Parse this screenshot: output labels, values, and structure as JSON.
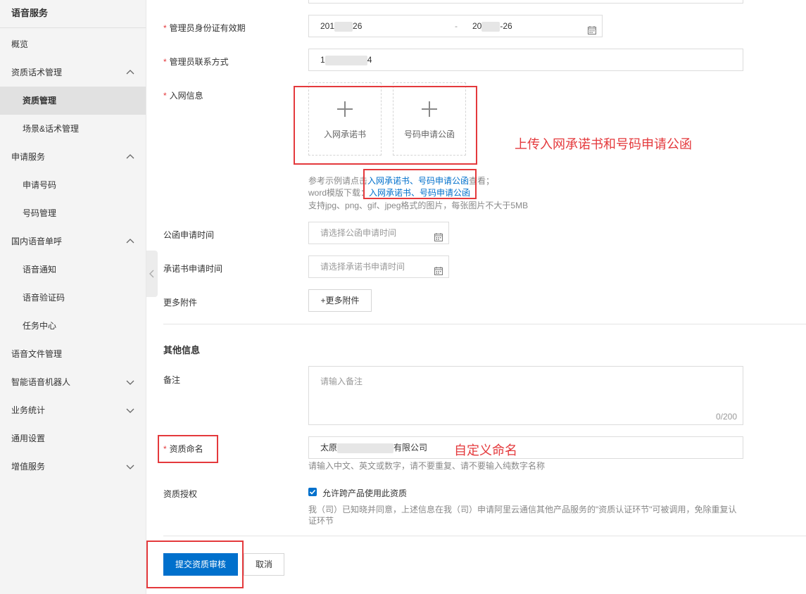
{
  "sidebar": {
    "title": "语音服务",
    "items": [
      {
        "label": "概览"
      },
      {
        "label": "资质话术管理"
      },
      {
        "label": "资质管理"
      },
      {
        "label": "场景&话术管理"
      },
      {
        "label": "申请服务"
      },
      {
        "label": "申请号码"
      },
      {
        "label": "号码管理"
      },
      {
        "label": "国内语音单呼"
      },
      {
        "label": "语音通知"
      },
      {
        "label": "语音验证码"
      },
      {
        "label": "任务中心"
      },
      {
        "label": "语音文件管理"
      },
      {
        "label": "智能语音机器人"
      },
      {
        "label": "业务统计"
      },
      {
        "label": "通用设置"
      },
      {
        "label": "增值服务"
      }
    ]
  },
  "form": {
    "required_mark": "*",
    "id_validity": {
      "label": "管理员身份证有效期",
      "start_prefix": "201",
      "start_suffix": "26",
      "separator": "-",
      "end_prefix": "20",
      "end_suffix": "-26"
    },
    "contact": {
      "label": "管理员联系方式",
      "prefix": "1",
      "suffix": "4"
    },
    "network_info": {
      "label": "入网信息",
      "upload1": "入网承诺书",
      "upload2": "号码申请公函"
    },
    "hints": {
      "line1_prefix": "参考示例请点击",
      "line1_links": "入网承诺书、号码申请公函",
      "line1_suffix": "查看；",
      "line2_prefix": "word模版下载：",
      "line2_links": "入网承诺书、号码申请公函",
      "line3": "支持jpg、png、gif、jpeg格式的图片，每张图片不大于5MB"
    },
    "letter_time": {
      "label": "公函申请时间",
      "placeholder": "请选择公函申请时间"
    },
    "promise_time": {
      "label": "承诺书申请时间",
      "placeholder": "请选择承诺书申请时间"
    },
    "more_attach": {
      "label": "更多附件",
      "button": "+更多附件"
    },
    "other_section": "其他信息",
    "remark": {
      "label": "备注",
      "placeholder": "请输入备注",
      "counter": "0/200"
    },
    "qual_name": {
      "label": "资质命名",
      "value_prefix": "太原",
      "value_suffix": "有限公司",
      "hint": "请输入中文、英文或数字，请不要重复、请不要输入纯数字名称"
    },
    "qual_auth": {
      "label": "资质授权",
      "checkbox_label": "允许跨产品使用此资质",
      "desc_line1": "我（司）已知晓并同意，上述信息在我（司）申请阿里云通信其他产品服务的\"资质认证环节\"可被调用，免除重复认",
      "desc_line2": "证环节"
    },
    "submit": "提交资质审核",
    "cancel": "取消"
  },
  "annotations": {
    "upload_note": "上传入网承诺书和号码申请公函",
    "name_note": "自定义命名"
  },
  "colors": {
    "primary": "#0070cc",
    "annotation": "#e4393c",
    "sidebar_bg": "#f4f4f4"
  }
}
